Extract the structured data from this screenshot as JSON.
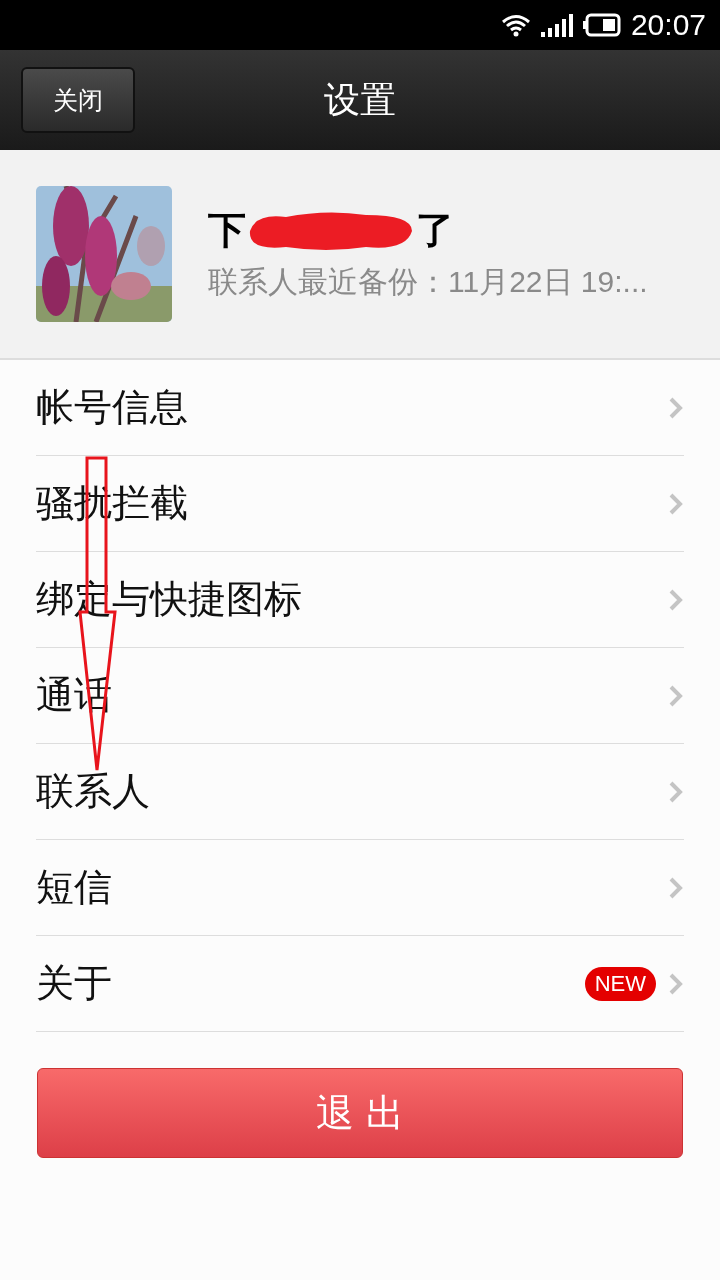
{
  "status_bar": {
    "time": "20:07"
  },
  "header": {
    "close_button": "关闭",
    "title": "设置"
  },
  "profile": {
    "name_start": "下",
    "name_end": "了",
    "subtitle": "联系人最近备份：11月22日 19:..."
  },
  "menu_items": [
    {
      "label": "帐号信息"
    },
    {
      "label": "骚扰拦截"
    },
    {
      "label": "绑定与快捷图标"
    },
    {
      "label": "通话"
    },
    {
      "label": "联系人"
    },
    {
      "label": "短信"
    },
    {
      "label": "关于",
      "badge": "NEW"
    }
  ],
  "logout_button": "退 出"
}
